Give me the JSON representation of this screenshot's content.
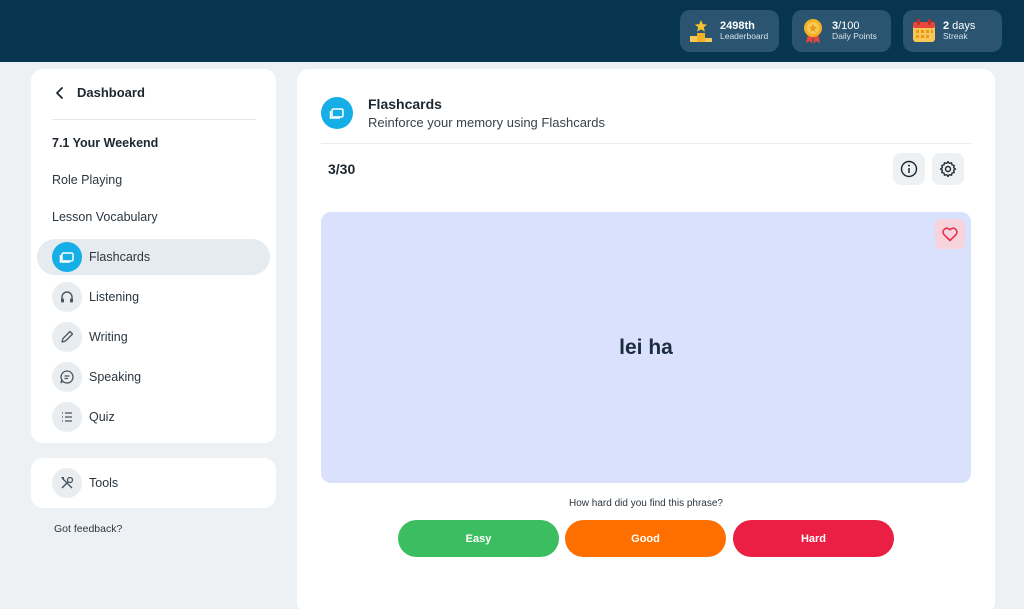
{
  "topbar": {
    "leaderboard": {
      "value": "2498th",
      "label": "Leaderboard",
      "icon": "trophy-podium-icon"
    },
    "daily_points": {
      "value": "3",
      "unit": "/100",
      "label": "Daily Points",
      "icon": "medal-icon"
    },
    "streak": {
      "value": "2",
      "unit": " days",
      "label": "Streak",
      "icon": "calendar-icon"
    }
  },
  "sidebar": {
    "back_label": "Dashboard",
    "lesson_title": "7.1 Your Weekend",
    "plain_items": [
      "Role Playing",
      "Lesson Vocabulary"
    ],
    "nav_items": [
      {
        "label": "Flashcards",
        "icon": "flashcard-icon",
        "active": true
      },
      {
        "label": "Listening",
        "icon": "headphones-icon",
        "active": false
      },
      {
        "label": "Writing",
        "icon": "pencil-icon",
        "active": false
      },
      {
        "label": "Speaking",
        "icon": "speech-bubble-icon",
        "active": false
      },
      {
        "label": "Quiz",
        "icon": "list-icon",
        "active": false
      }
    ],
    "tools_label": "Tools",
    "feedback_label": "Got feedback?"
  },
  "main": {
    "title": "Flashcards",
    "subtitle": "Reinforce your memory using Flashcards",
    "progress": "3/30",
    "card_phrase": "lei ha",
    "question": "How hard did you find this phrase?",
    "buttons": {
      "easy": "Easy",
      "good": "Good",
      "hard": "Hard"
    }
  },
  "colors": {
    "topbar": "#073550",
    "accent": "#16aee6",
    "card": "#d9e1fc",
    "easy": "#3cbe60",
    "good": "#ff6f00",
    "hard": "#eb1e43"
  }
}
